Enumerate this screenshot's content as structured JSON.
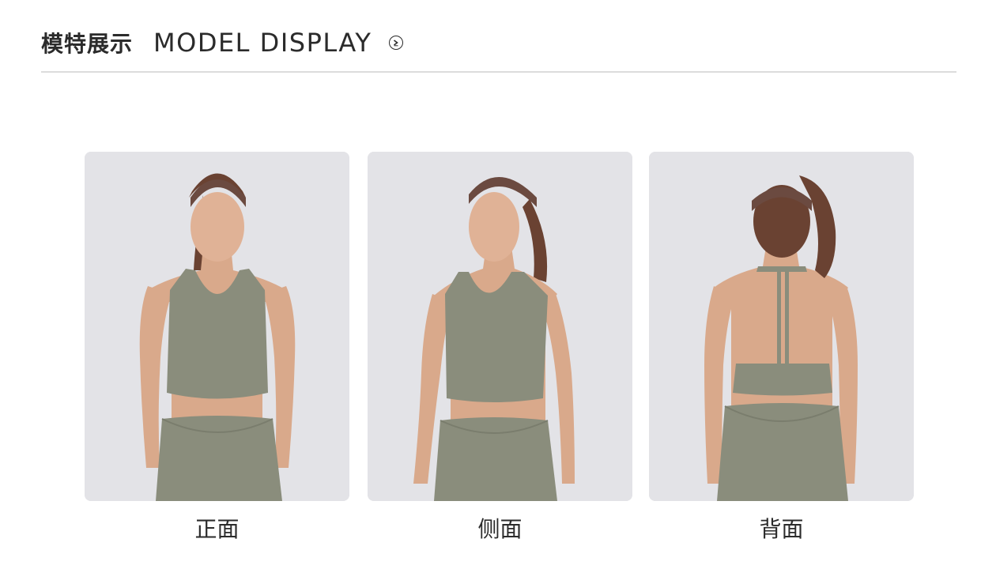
{
  "header": {
    "title_cn": "模特展示",
    "title_en": "MODEL DISPLAY",
    "arrow_icon": "chevron-right-circle-icon"
  },
  "gallery": [
    {
      "caption": "正面",
      "view": "front"
    },
    {
      "caption": "侧面",
      "view": "side"
    },
    {
      "caption": "背面",
      "view": "back"
    }
  ],
  "colors": {
    "text": "#2b2b2b",
    "background": "#ffffff",
    "photo_bg": "#e3e3e7",
    "garment": "#8a8d7c",
    "skin": "#d9a98b",
    "headband": "#6b4a40",
    "hair": "#6a4232"
  }
}
